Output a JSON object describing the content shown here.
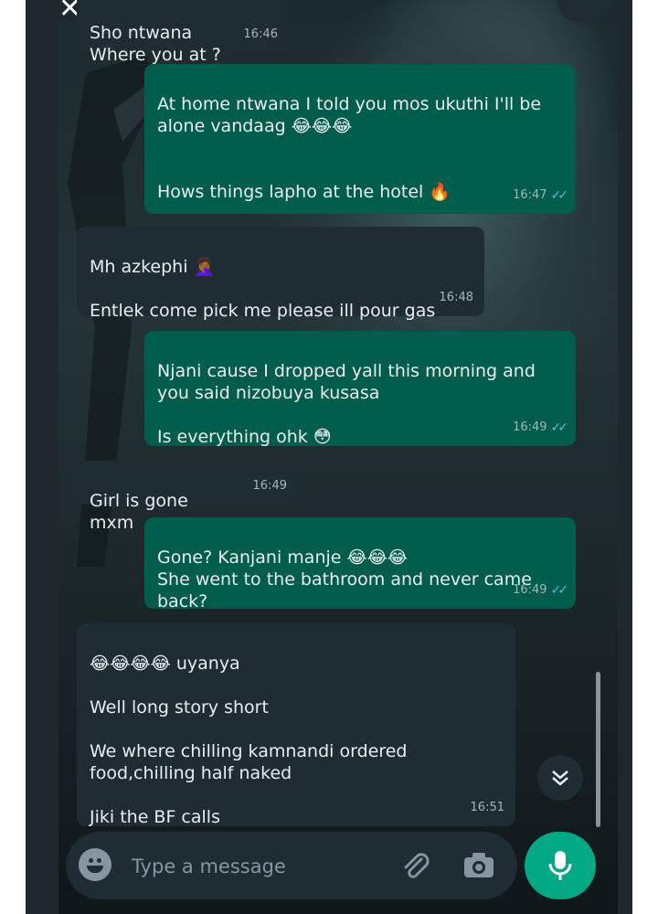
{
  "messages": [
    {
      "dir": "in",
      "text": "Sho ntwana\nWhere you at ?",
      "time": "16:46"
    },
    {
      "dir": "out",
      "text": "At home ntwana I told you mos ukuthi I'll be alone vandaag 😂😂😂\n\n\nHows things lapho at the hotel 🔥",
      "time": "16:47",
      "ticks": "✓✓"
    },
    {
      "dir": "in",
      "text": "Mh azkephi 🤦🏾‍♀️\n\nEntlek come pick me please ill pour gas",
      "time": "16:48"
    },
    {
      "dir": "out",
      "text": "Njani cause I dropped yall this morning and you said nizobuya kusasa\n\nIs everything ohk 😳",
      "time": "16:49",
      "ticks": "✓✓"
    },
    {
      "dir": "in",
      "text": "Girl is gone mxm",
      "time": "16:49"
    },
    {
      "dir": "out",
      "text": "Gone? Kanjani manje 😂😂😂\nShe went to the bathroom and never came back?",
      "time": "16:49",
      "ticks": "✓✓"
    },
    {
      "dir": "in",
      "text": "😂😂😂😂 uyanya\n\nWell long story short\n\nWe where chilling  kamnandi ordered food,chilling half naked\n\nJiki the BF calls",
      "time": "16:51"
    }
  ],
  "composer": {
    "placeholder": "Type a message"
  },
  "icons": {
    "close": "close-icon",
    "emoji": "emoji-icon",
    "attach": "paperclip-icon",
    "camera": "camera-icon",
    "mic": "mic-icon",
    "scroll_down": "double-chevron-down-icon"
  },
  "colors": {
    "incoming": "#1f2c34",
    "outgoing": "#005c4b",
    "read_ticks": "#53bdeb",
    "mic": "#00a884"
  }
}
